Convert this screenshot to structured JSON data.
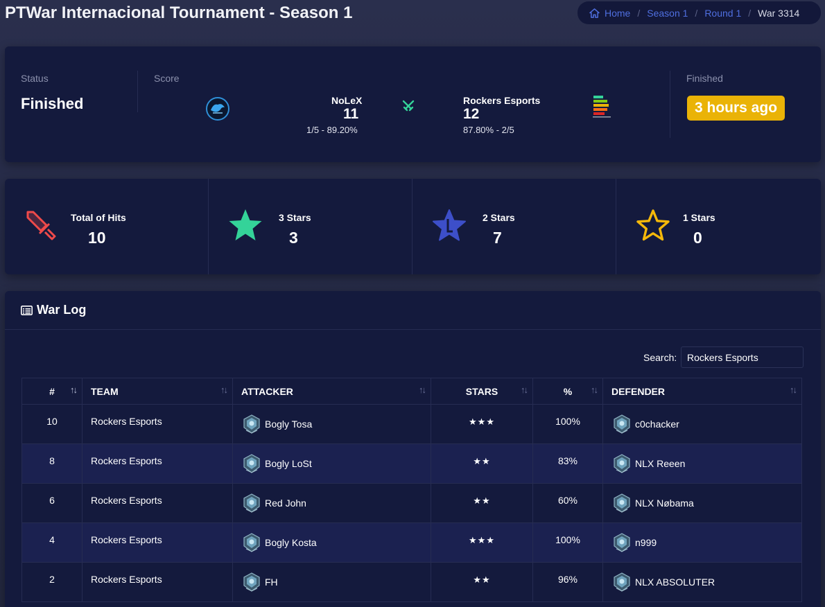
{
  "page": {
    "title": "PTWar Internacional Tournament - Season 1"
  },
  "breadcrumb": {
    "home": "Home",
    "season": "Season 1",
    "round": "Round 1",
    "current": "War 3314",
    "separator": "/"
  },
  "status_card": {
    "status_label": "Status",
    "status_value": "Finished",
    "score_label": "Score",
    "team_a": {
      "name": "NoLeX",
      "score": "11",
      "sub": "1/5 - 89.20%"
    },
    "team_b": {
      "name": "Rockers Esports",
      "score": "12",
      "sub": "87.80% - 2/5"
    },
    "finished_label": "Finished",
    "finished_ago": "3 hours ago"
  },
  "stats": [
    {
      "label": "Total of Hits",
      "value": "10",
      "icon": "sword-icon"
    },
    {
      "label": "3 Stars",
      "value": "3",
      "icon": "star-filled-icon"
    },
    {
      "label": "2 Stars",
      "value": "7",
      "icon": "star-half-icon"
    },
    {
      "label": "1 Stars",
      "value": "0",
      "icon": "star-outline-icon"
    }
  ],
  "colors": {
    "accent_blue": "#4f6fe0",
    "badge_yellow": "#eab307",
    "star_green": "#34d399",
    "star_blue": "#3d4fc9",
    "star_yellow": "#f5b80a",
    "sword_red": "#ef4a4a",
    "card_bg": "#141a3d"
  },
  "war_log": {
    "title": "War Log",
    "search_label": "Search:",
    "search_value": "Rockers Esports",
    "columns": [
      "#",
      "TEAM",
      "ATTACKER",
      "STARS",
      "%",
      "DEFENDER"
    ],
    "rows": [
      {
        "num": "10",
        "team": "Rockers Esports",
        "attacker": "Bogly Tosa",
        "stars": "★★★",
        "pct": "100%",
        "defender": "c0chacker"
      },
      {
        "num": "8",
        "team": "Rockers Esports",
        "attacker": "Bogly LoSt",
        "stars": "★★",
        "pct": "83%",
        "defender": "NLX Reeen"
      },
      {
        "num": "6",
        "team": "Rockers Esports",
        "attacker": "Red John",
        "stars": "★★",
        "pct": "60%",
        "defender": "NLX Nøbama"
      },
      {
        "num": "4",
        "team": "Rockers Esports",
        "attacker": "Bogly Kosta",
        "stars": "★★★",
        "pct": "100%",
        "defender": "n999"
      },
      {
        "num": "2",
        "team": "Rockers Esports",
        "attacker": "FH",
        "stars": "★★",
        "pct": "96%",
        "defender": "NLX ABSOLUTER"
      }
    ]
  }
}
